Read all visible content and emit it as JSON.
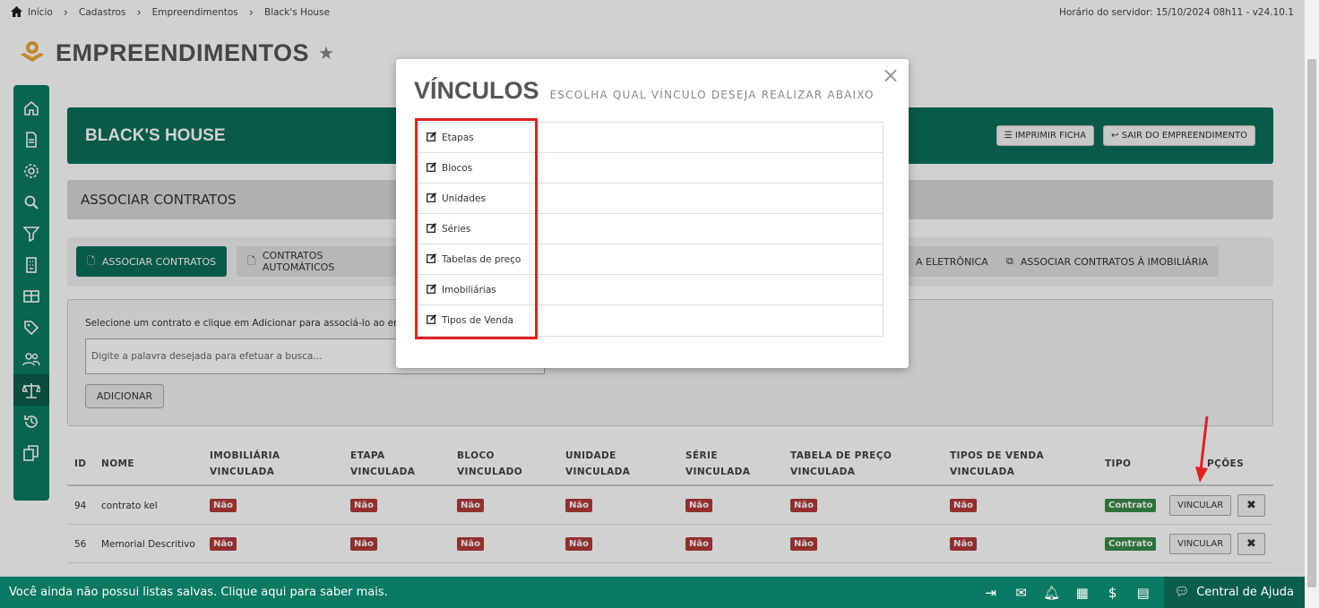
{
  "breadcrumb": {
    "items": [
      "Início",
      "Cadastros",
      "Empreendimentos",
      "Black's House"
    ]
  },
  "server_time": "Horário do servidor: 15/10/2024 08h11 - v24.10.1",
  "header": {
    "title": "EMPREENDIMENTOS"
  },
  "banner": {
    "title": "BLACK'S HOUSE",
    "print_label": "IMPRIMIR FICHA",
    "exit_label": "SAIR DO EMPREENDIMENTO"
  },
  "section": {
    "title": "ASSOCIAR CONTRATOS"
  },
  "tabs": [
    {
      "label": "ASSOCIAR CONTRATOS"
    },
    {
      "label": "CONTRATOS AUTOMÁTICOS"
    },
    {
      "label": "A ELETRÔNICA"
    },
    {
      "label": "ASSOCIAR CONTRATOS À IMOBILIÁRIA"
    }
  ],
  "form": {
    "instruction": "Selecione um contrato e clique em Adicionar para associá-lo ao empre",
    "search_placeholder": "Digite a palavra desejada para efetuar a busca...",
    "add_label": "ADICIONAR"
  },
  "table": {
    "headers": {
      "id": "ID",
      "nome": "NOME",
      "imob1": "IMOBILIÁRIA",
      "imob2": "VINCULADA",
      "etapa1": "ETAPA",
      "etapa2": "VINCULADA",
      "bloco1": "BLOCO",
      "bloco2": "VINCULADO",
      "unid1": "UNIDADE",
      "unid2": "VINCULADA",
      "serie1": "SÉRIE",
      "serie2": "VINCULADA",
      "tab1": "TABELA DE PREÇO",
      "tab2": "VINCULADA",
      "tipos1": "TIPOS DE VENDA",
      "tipos2": "VINCULADA",
      "tipo": "TIPO",
      "opcoes": "PÇÕES"
    },
    "rows": [
      {
        "id": "94",
        "nome": "contrato kel",
        "imob": "Não",
        "etapa": "Não",
        "bloco": "Não",
        "unidade": "Não",
        "serie": "Não",
        "tabela": "Não",
        "tipos": "Não",
        "tipo": "Contrato",
        "vincular": "VINCULAR"
      },
      {
        "id": "56",
        "nome": "Memorial Descritivo",
        "imob": "Não",
        "etapa": "Não",
        "bloco": "Não",
        "unidade": "Não",
        "serie": "Não",
        "tabela": "Não",
        "tipos": "Não",
        "tipo": "Contrato",
        "vincular": "VINCULAR"
      }
    ]
  },
  "modal": {
    "title": "VÍNCULOS",
    "subtitle": "ESCOLHA QUAL VÍNCULO DESEJA REALIZAR ABAIXO",
    "items": [
      "Etapas",
      "Blocos",
      "Unidades",
      "Séries",
      "Tabelas de preço",
      "Imobiliárias",
      "Tipos de Venda"
    ]
  },
  "footer": {
    "message": "Você ainda não possui listas salvas. Clique aqui para saber mais.",
    "help_label": "Central de Ajuda"
  },
  "colors": {
    "primary": "#0b7a63",
    "danger": "#b23a3a",
    "success": "#3a8a4a",
    "highlight": "#e02020"
  }
}
